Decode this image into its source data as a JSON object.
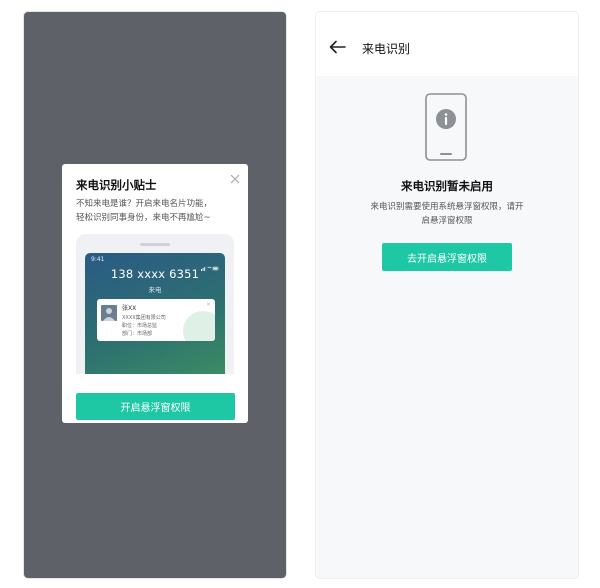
{
  "theme": {
    "accent": "#1ec8a5",
    "overlay": "#5f6168"
  },
  "tips_dialog": {
    "title": "来电识别小贴士",
    "desc_line1": "不知来电是谁？开启来电名片功能，",
    "desc_line2": "轻松识别同事身份，来电不再尴尬~",
    "close_icon": "close-icon",
    "preview": {
      "status_time": "9:41",
      "phone_number": "138 xxxx 6351",
      "call_label": "来电",
      "card": {
        "name": "张XX",
        "company": "XXXX集团有限公司",
        "position": "职位：市场总监",
        "department": "部门：市场部"
      }
    },
    "button_label": "开启悬浮窗权限"
  },
  "caller_id_page": {
    "title": "来电识别",
    "back_icon": "arrow-left-icon",
    "empty_icon": "phone-info-icon",
    "empty_title": "来电识别暂未启用",
    "desc_line1": "来电识别需要使用系统悬浮窗权限，请开",
    "desc_line2": "启悬浮窗权限",
    "button_label": "去开启悬浮窗权限"
  }
}
